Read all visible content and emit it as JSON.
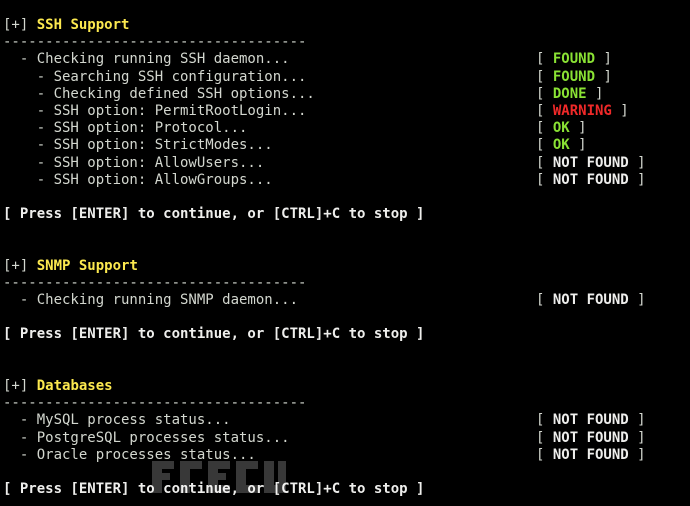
{
  "sections": [
    {
      "marker": "[+]",
      "title": "SSH Support",
      "separator": "------------------------------------",
      "checks": [
        {
          "label": "  - Checking running SSH daemon...",
          "status": "FOUND",
          "color": "green"
        },
        {
          "label": "    - Searching SSH configuration...",
          "status": "FOUND",
          "color": "green"
        },
        {
          "label": "    - Checking defined SSH options...",
          "status": "DONE",
          "color": "green"
        },
        {
          "label": "    - SSH option: PermitRootLogin...",
          "status": "WARNING",
          "color": "red"
        },
        {
          "label": "    - SSH option: Protocol...",
          "status": "OK",
          "color": "green"
        },
        {
          "label": "    - SSH option: StrictModes...",
          "status": "OK",
          "color": "green"
        },
        {
          "label": "    - SSH option: AllowUsers...",
          "status": "NOT FOUND",
          "color": "white"
        },
        {
          "label": "    - SSH option: AllowGroups...",
          "status": "NOT FOUND",
          "color": "white"
        }
      ],
      "prompt": "[ Press [ENTER] to continue, or [CTRL]+C to stop ]"
    },
    {
      "marker": "[+]",
      "title": "SNMP Support",
      "separator": "------------------------------------",
      "checks": [
        {
          "label": "  - Checking running SNMP daemon...",
          "status": "NOT FOUND",
          "color": "white"
        }
      ],
      "prompt": "[ Press [ENTER] to continue, or [CTRL]+C to stop ]"
    },
    {
      "marker": "[+]",
      "title": "Databases",
      "separator": "------------------------------------",
      "checks": [
        {
          "label": "  - MySQL process status...",
          "status": "NOT FOUND",
          "color": "white"
        },
        {
          "label": "  - PostgreSQL processes status...",
          "status": "NOT FOUND",
          "color": "white"
        },
        {
          "label": "  - Oracle processes status...",
          "status": "NOT FOUND",
          "color": "white"
        }
      ],
      "prompt": "[ Press [ENTER] to continue, or [CTRL]+C to stop ]"
    }
  ],
  "colors": {
    "background": "#000000",
    "text": "#d3d7cf",
    "title": "#fce94f",
    "green": "#8ae234",
    "red": "#ef2929",
    "white": "#eeeeec"
  },
  "watermark": {
    "icon": "freebuf-watermark-logo"
  }
}
